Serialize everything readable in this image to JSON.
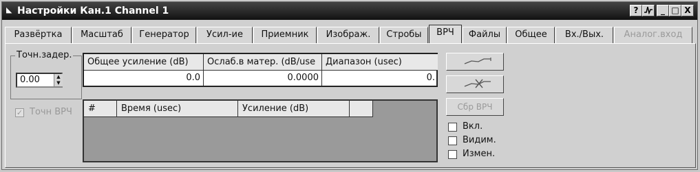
{
  "window": {
    "title": "Настройки Кан.1 Channel 1",
    "controls": [
      "?",
      "⁄∿",
      "_",
      "□",
      "X"
    ]
  },
  "tabs": [
    {
      "label": "Развёртка"
    },
    {
      "label": "Масштаб"
    },
    {
      "label": "Генератор"
    },
    {
      "label": "Усил-ие"
    },
    {
      "label": "Приемник"
    },
    {
      "label": "Изображ."
    },
    {
      "label": "Стробы"
    },
    {
      "label": "ВРЧ",
      "active": true
    },
    {
      "label": "Файлы"
    },
    {
      "label": "Общее"
    },
    {
      "label": "Вх./Вых."
    },
    {
      "label": "Аналог.вход",
      "disabled": true
    }
  ],
  "delay_group": {
    "label": "Точн.задер.",
    "value": "0.00"
  },
  "precise_vrch": {
    "label": "Точн ВРЧ",
    "checked": true,
    "disabled": true
  },
  "gain_table": {
    "headers": [
      "Общее усиление (dB)",
      "Ослаб.в матер. (dB/use",
      "Диапазон (usec)"
    ],
    "values": [
      "0.0",
      "0.0000",
      "0."
    ]
  },
  "points_table": {
    "headers": [
      "#",
      "Время (usec)",
      "Усиление (dB)",
      ""
    ]
  },
  "buttons": {
    "curve_icon": "curve-icon",
    "curve_cross_icon": "curve-cross-icon",
    "reset_label": "Сбр ВРЧ"
  },
  "checkboxes": [
    {
      "label": "Вкл.",
      "checked": false
    },
    {
      "label": "Видим.",
      "checked": false
    },
    {
      "label": "Измен.",
      "checked": false
    }
  ]
}
